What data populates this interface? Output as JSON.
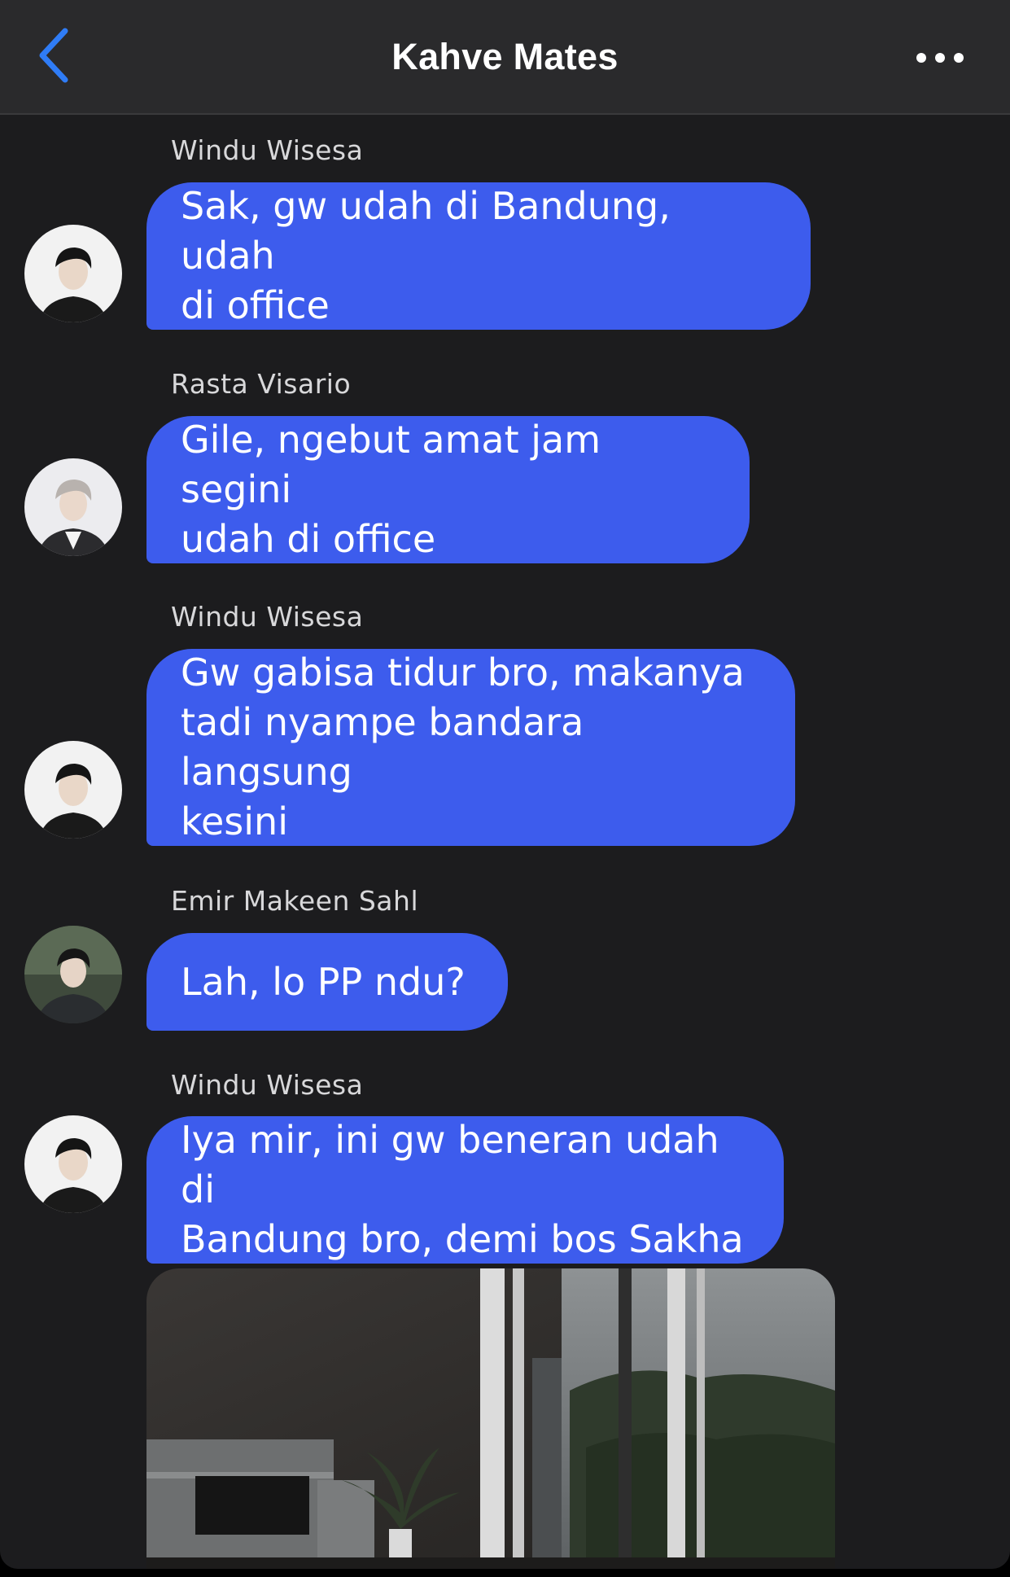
{
  "header": {
    "title": "Kahve Mates",
    "back_icon": "chevron-left-icon",
    "more_icon": "ellipsis-icon",
    "accent_color": "#2f7cf6"
  },
  "colors": {
    "background": "#1c1c1e",
    "header_background": "#2a2a2c",
    "bubble": "#3d5ced"
  },
  "messages": [
    {
      "sender": "Windu Wisesa",
      "text": "Sak, gw udah di Bandung, udah\ndi office"
    },
    {
      "sender": "Rasta Visario",
      "text": "Gile, ngebut amat jam segini\nudah di office"
    },
    {
      "sender": "Windu Wisesa",
      "text": "Gw gabisa tidur bro, makanya\ntadi nyampe bandara langsung\nkesini"
    },
    {
      "sender": "Emir Makeen Sahl",
      "text": "Lah, lo PP ndu?"
    },
    {
      "sender": "Windu Wisesa",
      "text": "Iya mir, ini gw beneran udah di\nBandung bro, demi bos Sakha"
    }
  ]
}
